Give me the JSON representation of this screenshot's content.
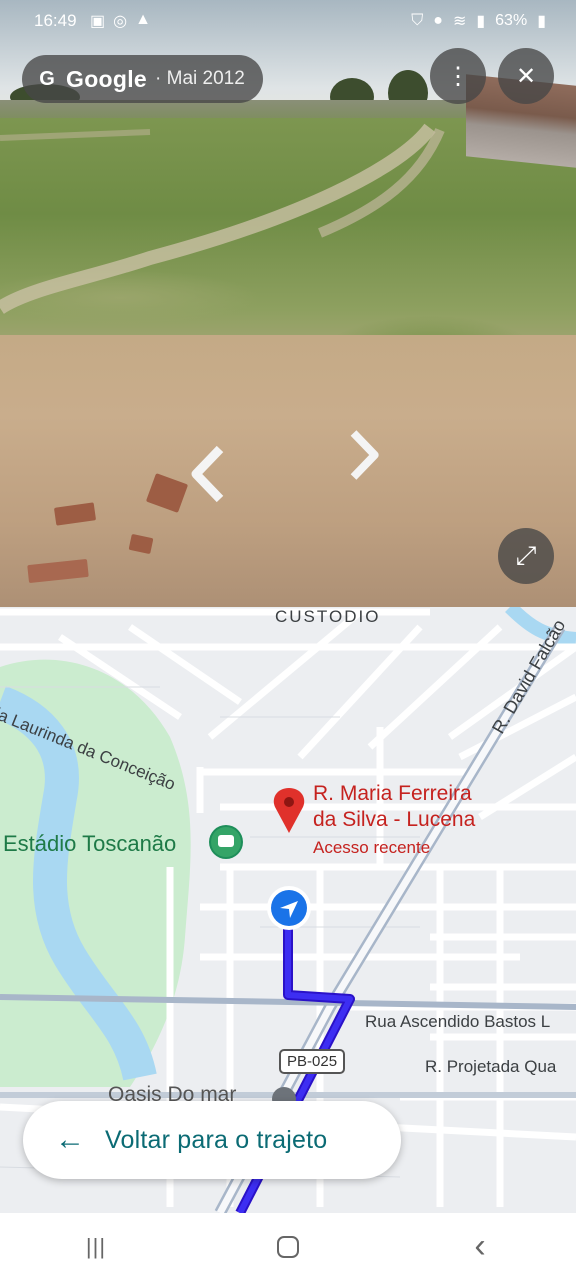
{
  "status_bar": {
    "time": "16:49",
    "battery": "63%",
    "left_icons": [
      "photo-icon",
      "instagram-icon",
      "warning-icon"
    ],
    "right_icons": [
      "shield-icon",
      "location-icon",
      "wifi-icon",
      "signal-icon",
      "battery-icon"
    ]
  },
  "streetview": {
    "brand": "Google",
    "date": "· Mai 2012",
    "menu_icon": "more-vert-icon",
    "close_icon": "close-icon",
    "expand_icon": "expand-icon",
    "nav_left_icon": "chevron-left-icon",
    "nav_right_icon": "chevron-right-icon"
  },
  "map": {
    "streets": {
      "custodio": "CUSTODIO",
      "laurinda": "ria Laurinda da Conceição",
      "david": "R. David Falcão",
      "ascendido": "Rua Ascendido Bastos L",
      "projetada": "R. Projetada Qua",
      "route_shield": "PB-025"
    },
    "places": {
      "stadium": "Estádio Toscanão",
      "oasis": "Oasis Do mar"
    },
    "destination": {
      "title_line1": "R. Maria Ferreira",
      "title_line2": "da Silva - Lucena",
      "subtitle": "Acesso recente"
    },
    "colors": {
      "route": "#3a1fe0",
      "water": "#a8d8f0",
      "park": "#c8ebce",
      "poi_red": "#c5221f",
      "accent_teal": "#0b6b74"
    }
  },
  "back_button": {
    "arrow": "←",
    "label": "Voltar para o trajeto"
  },
  "navbar": {
    "recents": "|||",
    "home": "○",
    "back": "‹"
  }
}
